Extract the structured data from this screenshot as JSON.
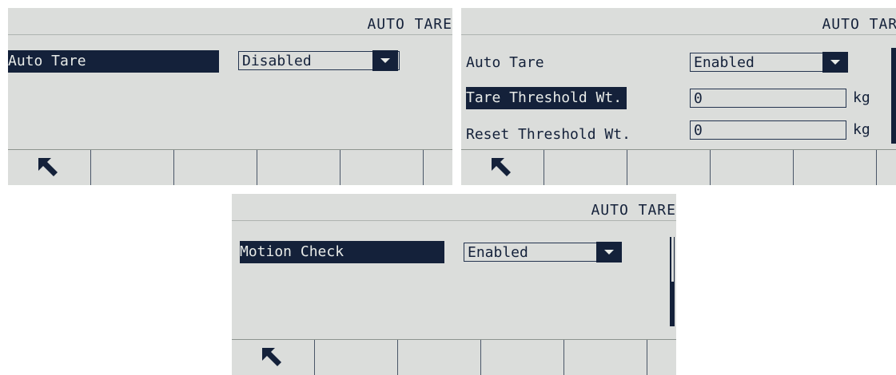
{
  "screens": [
    {
      "title": "AUTO TARE",
      "rows": [
        {
          "label": "Auto Tare",
          "value": "Disabled"
        }
      ]
    },
    {
      "title": "AUTO TARE",
      "rows": [
        {
          "label": "Auto Tare",
          "value": "Enabled"
        },
        {
          "label": "Tare Threshold Wt.",
          "value": "0",
          "unit": "kg"
        },
        {
          "label": "Reset Threshold Wt.",
          "value": "0",
          "unit": "kg"
        }
      ]
    },
    {
      "title": "AUTO TARE",
      "rows": [
        {
          "label": "Motion Check",
          "value": "Enabled"
        }
      ]
    }
  ],
  "softkeys": {
    "back_icon": "up-left-arrow-icon"
  },
  "colors": {
    "panel": "#dbdddb",
    "ink": "#14213a"
  }
}
